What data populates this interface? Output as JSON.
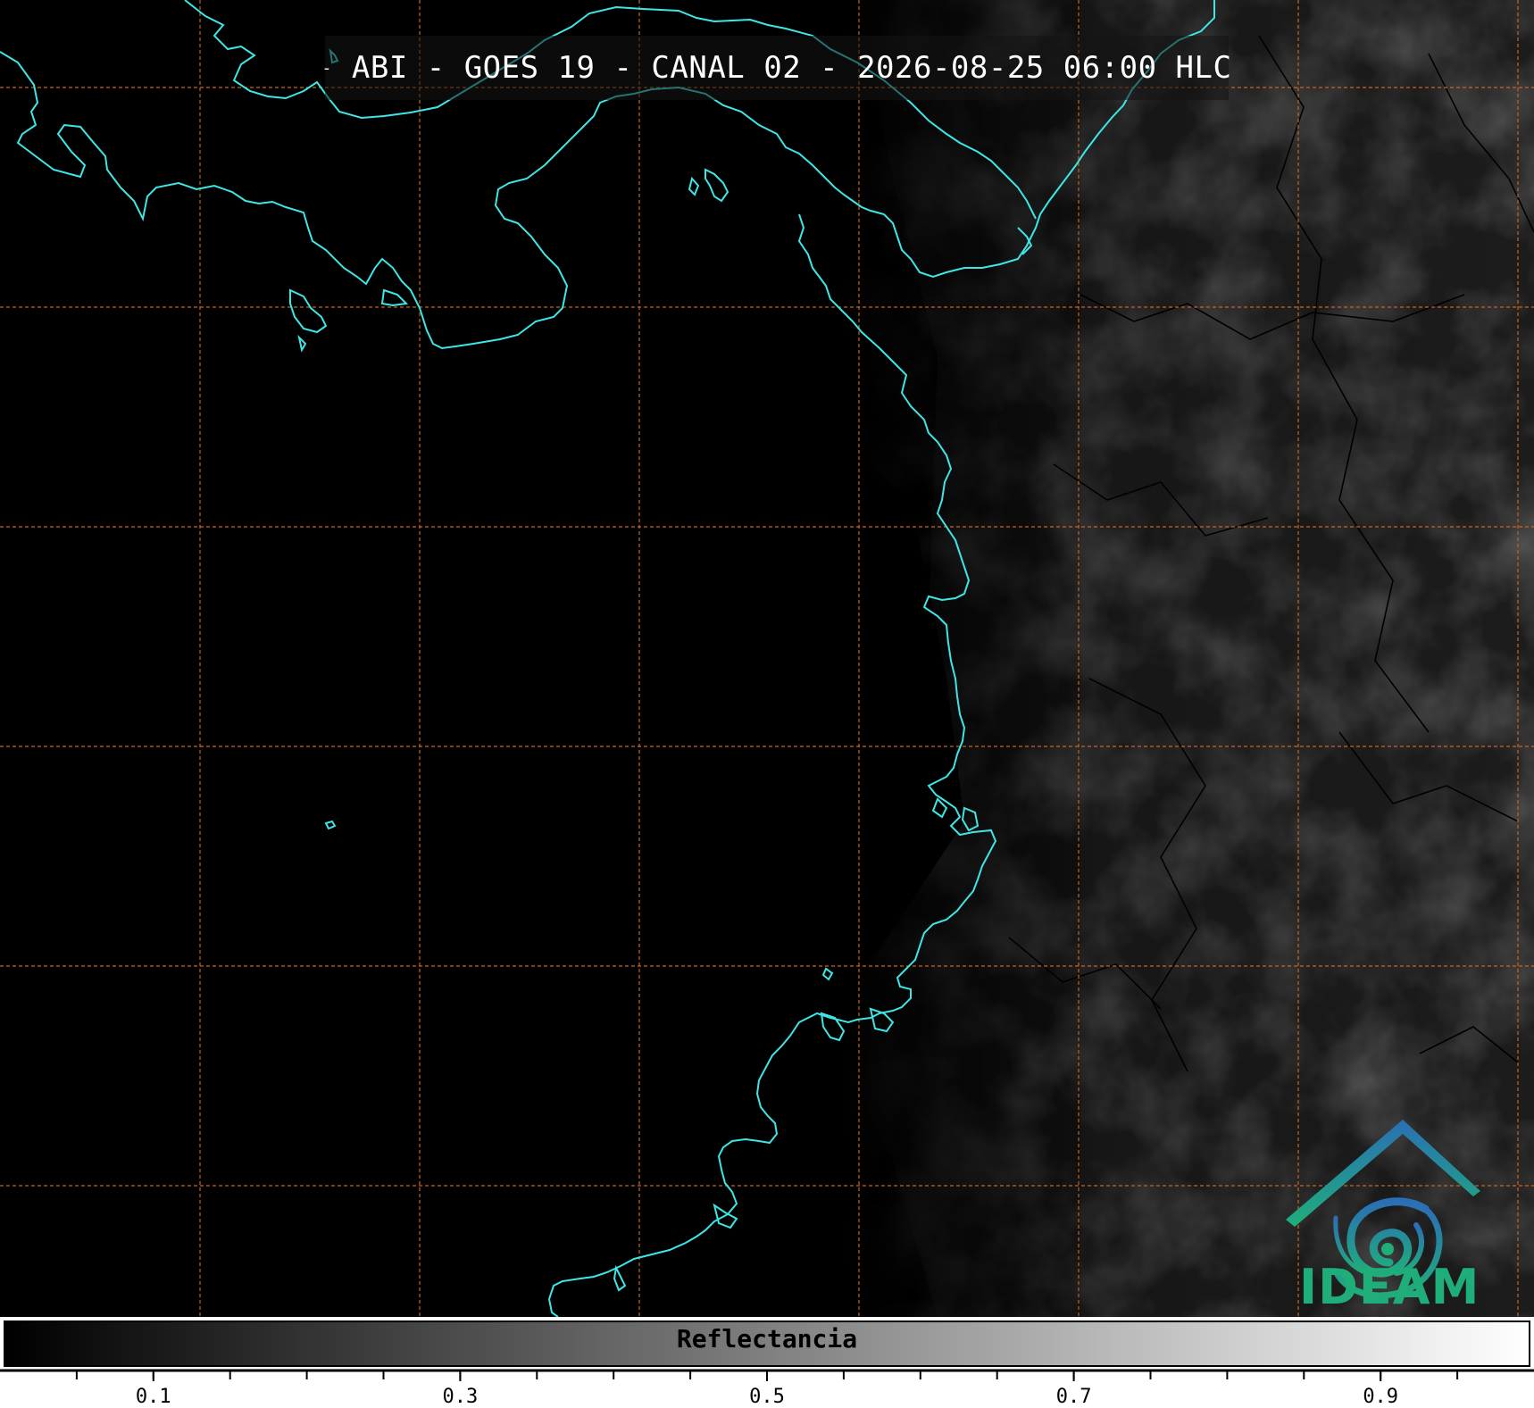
{
  "title": "ABI - GOES 19 - CANAL 02 - 2026-08-25 06:00 HLC",
  "title_prefix": "-",
  "logo": {
    "text": "IDEAM",
    "icon": "ideam-swirl-roof-icon"
  },
  "colorbar": {
    "label": "Reflectancia",
    "ticks": [
      "0.1",
      "0.3",
      "0.5",
      "0.7",
      "0.9"
    ],
    "range": [
      0.0,
      1.0
    ],
    "gradient": [
      "#000000",
      "#ffffff"
    ]
  },
  "colors": {
    "coastline": "#3ee6e6",
    "graticule": "#c8641e",
    "boundaries": "#000000",
    "logo_blue": "#2a6fb5",
    "logo_green": "#1fae7a"
  }
}
